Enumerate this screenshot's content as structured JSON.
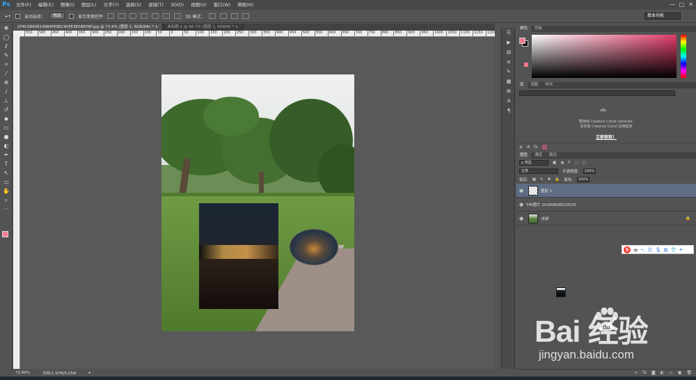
{
  "app": {
    "logo": "Ps",
    "menu": [
      "文件(F)",
      "编辑(E)",
      "图像(I)",
      "图层(L)",
      "文字(Y)",
      "选择(S)",
      "滤镜(T)",
      "3D(D)",
      "视图(V)",
      "窗口(W)",
      "帮助(H)"
    ],
    "window_controls": [
      "—",
      "□",
      "✕"
    ]
  },
  "options": {
    "auto_select_label": "自动选择：",
    "auto_select_value": "图层",
    "show_transform_label": "显示变换控件",
    "mode_3d_label": "3D 模式：",
    "workspace": "基本功能"
  },
  "tabs": [
    {
      "label": "2F4C0843814984FE9EC40FE3E5B878F.jpg @ 73.9% (图层 1, RGB/8#) *  ×",
      "active": true
    },
    {
      "label": "未标题-1 @ 66.7% (图层 1, RGB/8) *  ×",
      "active": false
    }
  ],
  "ruler": {
    "ticks": [
      "550",
      "500",
      "450",
      "400",
      "350",
      "300",
      "250",
      "200",
      "150",
      "100",
      "50",
      "0",
      "50",
      "100",
      "150",
      "200",
      "250",
      "300",
      "350",
      "400",
      "450",
      "500",
      "550",
      "600",
      "650",
      "700",
      "750",
      "800",
      "850",
      "900",
      "950",
      "1000",
      "1050",
      "1100",
      "1150",
      "1200"
    ]
  },
  "status": {
    "zoom": "73.94%",
    "doc_info": "文档:1.97M/5.05M"
  },
  "color_panel": {
    "tabs": [
      "颜色",
      "色板"
    ],
    "fg_color": "#f07a92",
    "bg_color": "#000000"
  },
  "library_panel": {
    "tabs": [
      "库",
      "调整",
      "样式"
    ],
    "text_line1": "要使用 Creative Cloud Libraries,",
    "text_line2": "请安装 Creative Cloud 应用程序",
    "link": "立即获取！"
  },
  "layers_panel": {
    "tabs": [
      "图层",
      "通道",
      "路径"
    ],
    "kind_filter": "ρ 类型",
    "blend_mode": "正常",
    "opacity_label": "不透明度:",
    "opacity_value": "100%",
    "lock_label": "锁定:",
    "fill_label": "填充:",
    "fill_value": "100%",
    "layers": [
      {
        "name": "图层 1",
        "selected": true,
        "thumb": "checker",
        "locked": false
      },
      {
        "name": "TIM图片 20180608210520",
        "selected": false,
        "thumb": "night",
        "locked": false
      },
      {
        "name": "背景",
        "selected": false,
        "thumb": "park",
        "locked": true
      }
    ]
  },
  "sogou": {
    "logo": "S",
    "items": [
      "中",
      "•,",
      "☺",
      "🎙",
      "▤",
      "👕",
      "✈"
    ]
  },
  "watermark": {
    "main": "Bai  经验",
    "paw_text": "du",
    "sub": "jingyan.baidu.com"
  }
}
